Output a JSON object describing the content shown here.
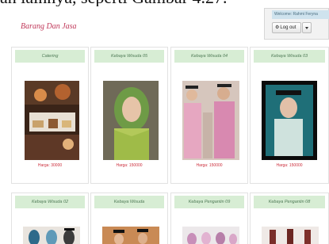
{
  "background_text": "an lainnya, seperti Gambar 4.27.",
  "header": {
    "welcome_text": "Welcome: Rahmi Feryna",
    "logout_label": "Log out"
  },
  "page_title": "Barang Dan Jasa",
  "products_row1": [
    {
      "name": "Catering",
      "price": "Harga: 30000"
    },
    {
      "name": "Kebaya Wisuda 05",
      "price": "Harga: 150000"
    },
    {
      "name": "Kebaya Wisuda 04",
      "price": "Harga: 150000"
    },
    {
      "name": "Kebaya Wisuda 03",
      "price": "Harga: 150000"
    }
  ],
  "products_row2": [
    {
      "name": "Kebaya Wisuda 02"
    },
    {
      "name": "Kebaya Wisuda"
    },
    {
      "name": "Kebaya Pengantin 09"
    },
    {
      "name": "Kebaya Pengantin 08"
    }
  ],
  "colors": {
    "title": "#c0395a",
    "card_header_bg": "#d7edd4",
    "price": "#cc2f3c"
  }
}
